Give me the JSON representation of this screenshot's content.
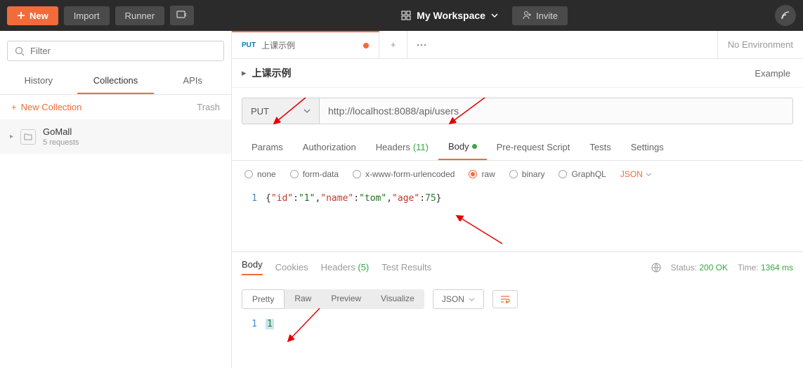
{
  "header": {
    "new_label": "New",
    "import_label": "Import",
    "runner_label": "Runner",
    "workspace_label": "My Workspace",
    "invite_label": "Invite"
  },
  "sidebar": {
    "filter_placeholder": "Filter",
    "tabs": {
      "history": "History",
      "collections": "Collections",
      "apis": "APIs"
    },
    "new_collection": "New Collection",
    "trash": "Trash",
    "collection": {
      "name": "GoMall",
      "sub": "5 requests"
    }
  },
  "request_tab": {
    "method": "PUT",
    "name": "上课示例",
    "add_tooltip": "+",
    "env": "No Environment"
  },
  "breadcrumb": {
    "name": "上课示例",
    "examples": "Example"
  },
  "request": {
    "method": "PUT",
    "url": "http://localhost:8088/api/users",
    "subtabs": {
      "params": "Params",
      "auth": "Authorization",
      "headers": "Headers",
      "headers_count": "(11)",
      "body": "Body",
      "prereq": "Pre-request Script",
      "tests": "Tests",
      "settings": "Settings"
    },
    "body_types": {
      "none": "none",
      "form_data": "form-data",
      "urlencoded": "x-www-form-urlencoded",
      "raw": "raw",
      "binary": "binary",
      "graphql": "GraphQL",
      "format": "JSON"
    },
    "body_code": {
      "line1_no": "1"
    }
  },
  "response": {
    "tabs": {
      "body": "Body",
      "cookies": "Cookies",
      "headers": "Headers",
      "headers_count": "(5)",
      "tests": "Test Results"
    },
    "status_label": "Status:",
    "status_code": "200 OK",
    "time_label": "Time:",
    "time_value": "1364 ms",
    "views": {
      "pretty": "Pretty",
      "raw": "Raw",
      "preview": "Preview",
      "visualize": "Visualize"
    },
    "format": "JSON",
    "body_code": {
      "line1_no": "1",
      "line1_text": "1"
    }
  },
  "json_body": {
    "id_key": "\"id\"",
    "id_val": "\"1\"",
    "name_key": "\"name\"",
    "name_val": "\"tom\"",
    "age_key": "\"age\"",
    "age_val": "75"
  }
}
